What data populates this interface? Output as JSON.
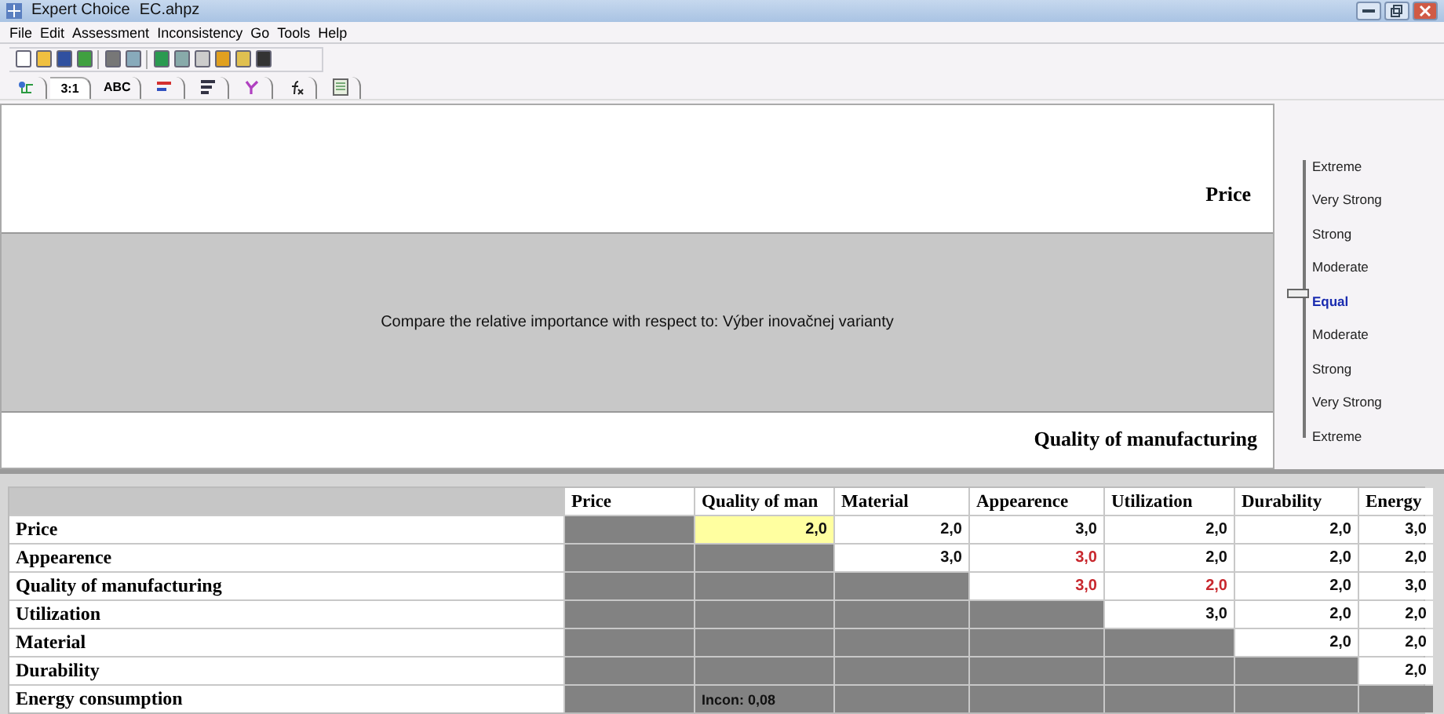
{
  "window": {
    "app": "Expert Choice",
    "file": "EC.ahpz"
  },
  "menu": [
    "File",
    "Edit",
    "Assessment",
    "Inconsistency",
    "Go",
    "Tools",
    "Help"
  ],
  "tabs": [
    {
      "kind": "tree",
      "selected": false
    },
    {
      "kind": "text",
      "label": "3:1",
      "selected": true
    },
    {
      "kind": "text",
      "label": "ABC",
      "selected": false
    },
    {
      "kind": "bars",
      "selected": false
    },
    {
      "kind": "lines",
      "selected": false
    },
    {
      "kind": "network",
      "selected": false
    },
    {
      "kind": "formula",
      "selected": false
    },
    {
      "kind": "sheet",
      "selected": false
    }
  ],
  "comparison": {
    "top": "Price",
    "prompt": "Compare the relative importance with respect to: Výber inovačnej varianty",
    "bottom": "Quality of manufacturing"
  },
  "scale": [
    {
      "label": "Extreme",
      "selected": false
    },
    {
      "label": "Very Strong",
      "selected": false
    },
    {
      "label": "Strong",
      "selected": false
    },
    {
      "label": "Moderate",
      "selected": false
    },
    {
      "label": "Equal",
      "selected": true
    },
    {
      "label": "Moderate",
      "selected": false
    },
    {
      "label": "Strong",
      "selected": false
    },
    {
      "label": "Very Strong",
      "selected": false
    },
    {
      "label": "Extreme",
      "selected": false
    }
  ],
  "matrix": {
    "columns": [
      "Price",
      "Quality of man",
      "Material",
      "Appearence",
      "Utilization",
      "Durability",
      "Energy"
    ],
    "rows": [
      {
        "label": "Price",
        "cells": [
          {
            "kind": "blank"
          },
          {
            "kind": "value",
            "text": "2,0",
            "inconsistent": false,
            "selected": true
          },
          {
            "kind": "value",
            "text": "2,0",
            "inconsistent": false,
            "selected": false
          },
          {
            "kind": "value",
            "text": "3,0",
            "inconsistent": false,
            "selected": false
          },
          {
            "kind": "value",
            "text": "2,0",
            "inconsistent": false,
            "selected": false
          },
          {
            "kind": "value",
            "text": "2,0",
            "inconsistent": false,
            "selected": false
          },
          {
            "kind": "value",
            "text": "3,0",
            "inconsistent": false,
            "selected": false
          }
        ]
      },
      {
        "label": "Appearence",
        "cells": [
          {
            "kind": "blank"
          },
          {
            "kind": "blank"
          },
          {
            "kind": "value",
            "text": "3,0",
            "inconsistent": false,
            "selected": false
          },
          {
            "kind": "value",
            "text": "3,0",
            "inconsistent": true,
            "selected": false
          },
          {
            "kind": "value",
            "text": "2,0",
            "inconsistent": false,
            "selected": false
          },
          {
            "kind": "value",
            "text": "2,0",
            "inconsistent": false,
            "selected": false
          },
          {
            "kind": "value",
            "text": "2,0",
            "inconsistent": false,
            "selected": false
          }
        ]
      },
      {
        "label": "Quality of manufacturing",
        "cells": [
          {
            "kind": "blank"
          },
          {
            "kind": "blank"
          },
          {
            "kind": "blank"
          },
          {
            "kind": "value",
            "text": "3,0",
            "inconsistent": true,
            "selected": false
          },
          {
            "kind": "value",
            "text": "2,0",
            "inconsistent": true,
            "selected": false
          },
          {
            "kind": "value",
            "text": "2,0",
            "inconsistent": false,
            "selected": false
          },
          {
            "kind": "value",
            "text": "3,0",
            "inconsistent": false,
            "selected": false
          }
        ]
      },
      {
        "label": "Utilization",
        "cells": [
          {
            "kind": "blank"
          },
          {
            "kind": "blank"
          },
          {
            "kind": "blank"
          },
          {
            "kind": "blank"
          },
          {
            "kind": "value",
            "text": "3,0",
            "inconsistent": false,
            "selected": false
          },
          {
            "kind": "value",
            "text": "2,0",
            "inconsistent": false,
            "selected": false
          },
          {
            "kind": "value",
            "text": "2,0",
            "inconsistent": false,
            "selected": false
          }
        ]
      },
      {
        "label": "Material",
        "cells": [
          {
            "kind": "blank"
          },
          {
            "kind": "blank"
          },
          {
            "kind": "blank"
          },
          {
            "kind": "blank"
          },
          {
            "kind": "blank"
          },
          {
            "kind": "value",
            "text": "2,0",
            "inconsistent": false,
            "selected": false
          },
          {
            "kind": "value",
            "text": "2,0",
            "inconsistent": false,
            "selected": false
          }
        ]
      },
      {
        "label": "Durability",
        "cells": [
          {
            "kind": "blank"
          },
          {
            "kind": "blank"
          },
          {
            "kind": "blank"
          },
          {
            "kind": "blank"
          },
          {
            "kind": "blank"
          },
          {
            "kind": "blank"
          },
          {
            "kind": "value",
            "text": "2,0",
            "inconsistent": false,
            "selected": false
          }
        ]
      },
      {
        "label": "Energy consumption",
        "cells": [
          {
            "kind": "blank"
          },
          {
            "kind": "note",
            "text": "Incon: 0,08"
          },
          {
            "kind": "blank"
          },
          {
            "kind": "blank"
          },
          {
            "kind": "blank"
          },
          {
            "kind": "blank"
          },
          {
            "kind": "blank"
          }
        ]
      }
    ]
  }
}
